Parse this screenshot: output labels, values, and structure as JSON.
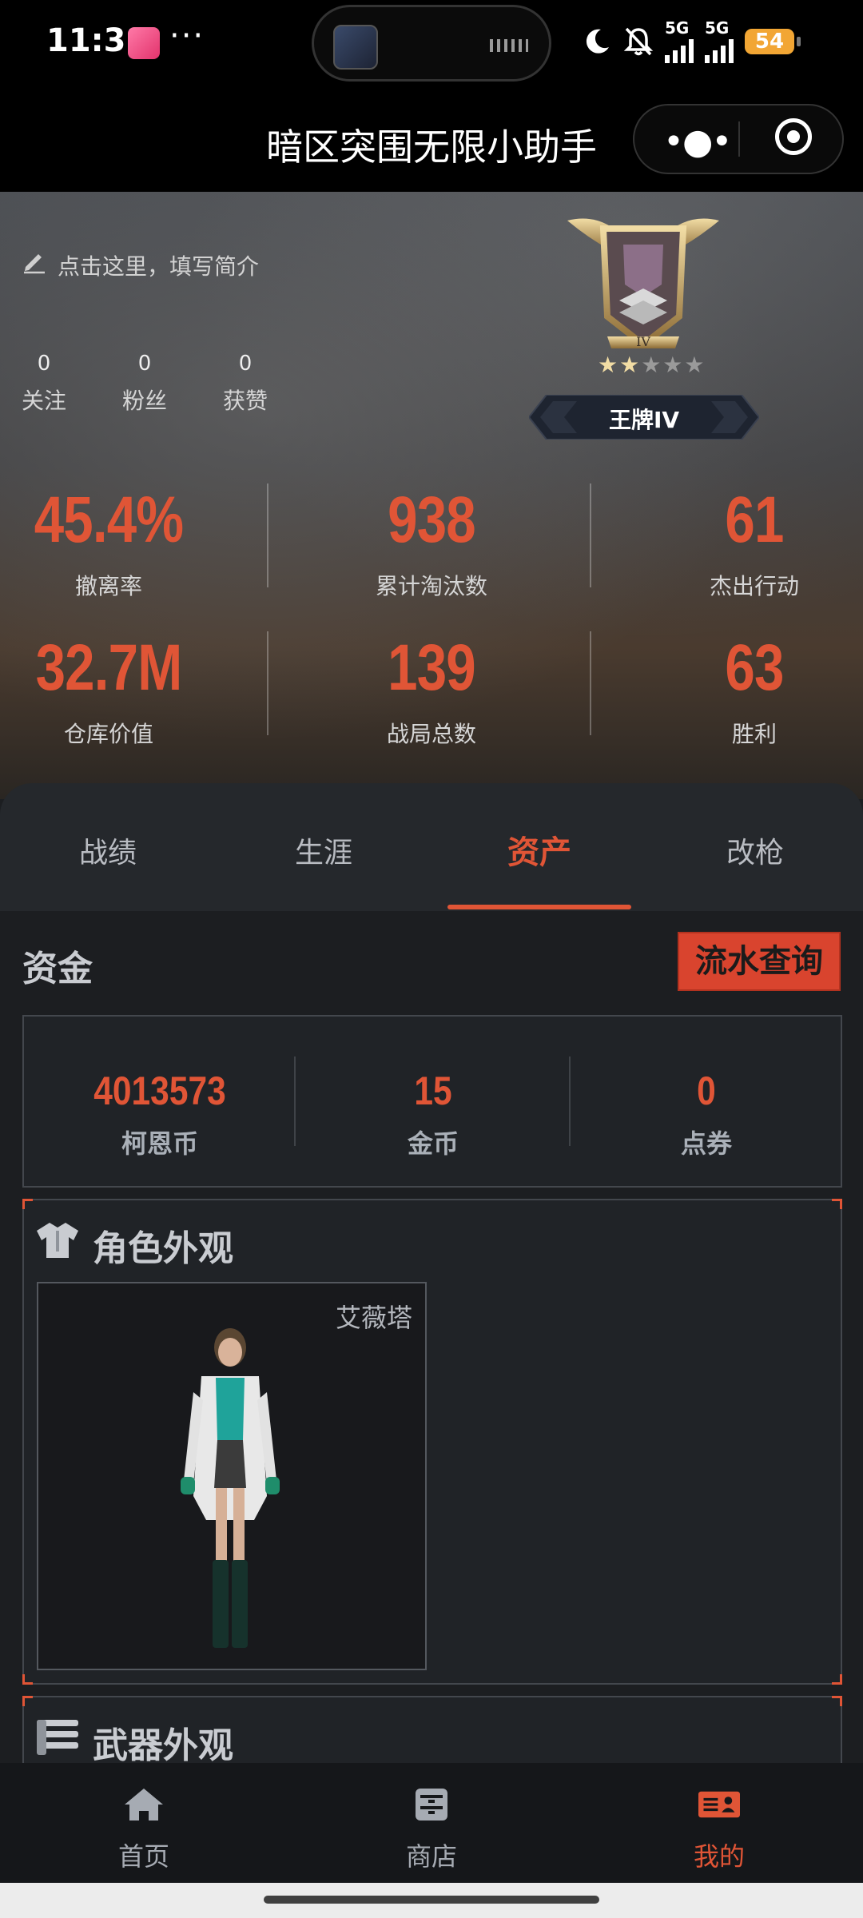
{
  "status_bar": {
    "time": "11:31",
    "more": "···",
    "network1": "5G",
    "network2": "5G",
    "battery": "54"
  },
  "header": {
    "title": "暗区突围无限小助手",
    "menu_icon": "more-dots-icon",
    "close_icon": "target-circle-icon"
  },
  "profile": {
    "bio_placeholder": "点击这里，填写简介",
    "social": [
      {
        "count": "0",
        "label": "关注"
      },
      {
        "count": "0",
        "label": "粉丝"
      },
      {
        "count": "0",
        "label": "获赞"
      }
    ],
    "rank": {
      "emblem_numeral": "IV",
      "stars_filled": 2,
      "stars_total": 5,
      "name": "王牌IV"
    },
    "stats": [
      {
        "value": "45.4%",
        "label": "撤离率"
      },
      {
        "value": "938",
        "label": "累计淘汰数"
      },
      {
        "value": "61",
        "label": "杰出行动"
      },
      {
        "value": "32.7M",
        "label": "仓库价值"
      },
      {
        "value": "139",
        "label": "战局总数"
      },
      {
        "value": "63",
        "label": "胜利"
      }
    ]
  },
  "tabs": [
    {
      "label": "战绩",
      "active": false
    },
    {
      "label": "生涯",
      "active": false
    },
    {
      "label": "资产",
      "active": true
    },
    {
      "label": "改枪",
      "active": false
    }
  ],
  "funds": {
    "title": "资金",
    "flow_button": "流水查询",
    "items": [
      {
        "value": "4013573",
        "label": "柯恩币"
      },
      {
        "value": "15",
        "label": "金币"
      },
      {
        "value": "0",
        "label": "点券"
      }
    ]
  },
  "appearance": {
    "title": "角色外观",
    "skins": [
      {
        "name": "艾薇塔"
      }
    ]
  },
  "weapons": {
    "title": "武器外观"
  },
  "bottom_nav": [
    {
      "label": "首页",
      "icon": "home-icon",
      "active": false
    },
    {
      "label": "商店",
      "icon": "store-icon",
      "active": false
    },
    {
      "label": "我的",
      "icon": "profile-card-icon",
      "active": true
    }
  ],
  "colors": {
    "accent": "#e05536",
    "background": "#1c1e21"
  }
}
